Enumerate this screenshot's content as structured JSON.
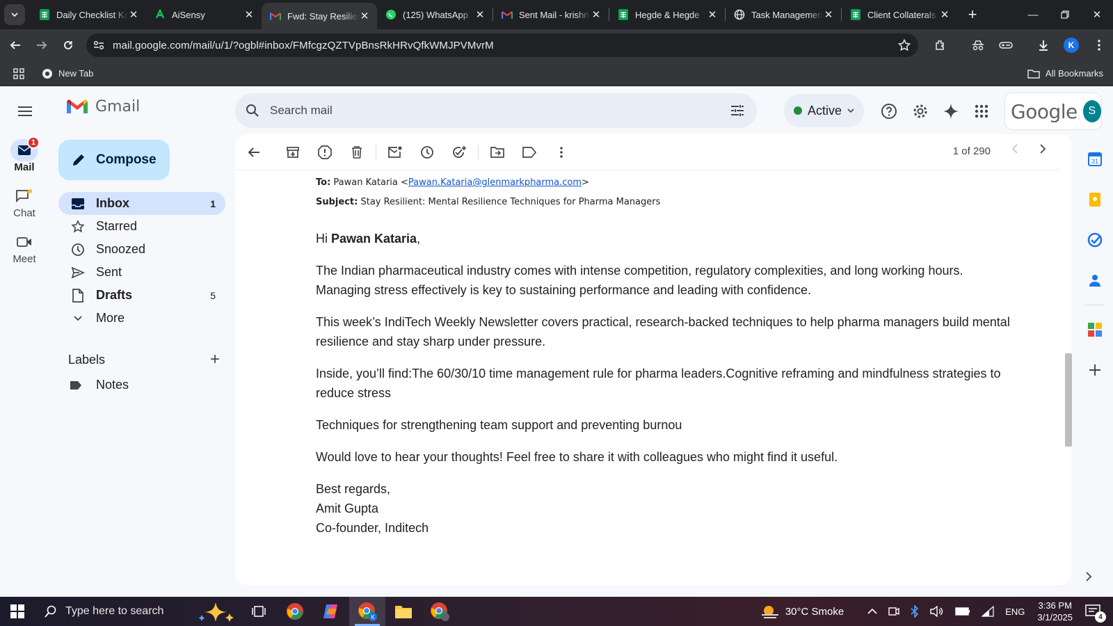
{
  "browser": {
    "tabs": [
      {
        "title": "Daily Checklist Ka",
        "icon": "sheets-icon",
        "active": false
      },
      {
        "title": "AiSensy",
        "icon": "aisensy-icon",
        "active": false
      },
      {
        "title": "Fwd: Stay Resilien",
        "icon": "gmail-icon",
        "active": true
      },
      {
        "title": "(125) WhatsApp",
        "icon": "whatsapp-icon",
        "active": false
      },
      {
        "title": "Sent Mail - krishn",
        "icon": "gmail-icon",
        "active": false
      },
      {
        "title": "Hegde & Hegde",
        "icon": "sheets-icon",
        "active": false
      },
      {
        "title": "Task Management",
        "icon": "globe-icon",
        "active": false
      },
      {
        "title": "Client Collaterals",
        "icon": "sheets-icon",
        "active": false
      }
    ],
    "url": "mail.google.com/mail/u/1/?ogbl#inbox/FMfcgzQZTVpBnsRkHRvQfkWMJPVMvrM",
    "profile_initial": "K",
    "bookmarks": {
      "new_tab": "New Tab",
      "all": "All Bookmarks"
    }
  },
  "gmail": {
    "brand": "Gmail",
    "search_placeholder": "Search mail",
    "status": "Active",
    "google_word": "Google",
    "avatar_initial": "S",
    "rail": [
      {
        "label": "Mail",
        "badge": "1"
      },
      {
        "label": "Chat"
      },
      {
        "label": "Meet"
      }
    ],
    "compose_label": "Compose",
    "nav": [
      {
        "label": "Inbox",
        "count": "1"
      },
      {
        "label": "Starred",
        "count": ""
      },
      {
        "label": "Snoozed",
        "count": ""
      },
      {
        "label": "Sent",
        "count": ""
      },
      {
        "label": "Drafts",
        "count": "5"
      },
      {
        "label": "More",
        "count": ""
      }
    ],
    "labels_title": "Labels",
    "labels": [
      "Notes"
    ],
    "pagination": "1 of 290"
  },
  "email": {
    "to_label": "To:",
    "to_name": "Pawan Kataria <",
    "to_email": "Pawan.Kataria@glenmarkpharma.com",
    "to_close": ">",
    "subject_label": "Subject:",
    "subject": "Stay Resilient: Mental Resilience Techniques for Pharma Managers",
    "greeting_hi": "Hi ",
    "greeting_name": "Pawan Kataria",
    "greeting_comma": ",",
    "paragraphs": [
      "The Indian pharmaceutical industry comes with intense competition, regulatory complexities, and long working hours. Managing stress effectively is key to sustaining performance and leading with confidence.",
      "This week’s IndiTech Weekly Newsletter covers practical, research-backed techniques to help pharma managers build mental resilience and stay sharp under pressure.",
      "Inside, you’ll find:The 60/30/10 time management rule for pharma leaders.Cognitive reframing and mindfulness strategies to reduce stress",
      "Techniques for strengthening team support and preventing burnou",
      "Would love to hear your thoughts! Feel free to share it with colleagues who might find it useful."
    ],
    "signoff": "Best regards,",
    "sender_name": "Amit Gupta",
    "sender_title": "Co-founder, Inditech"
  },
  "taskbar": {
    "search_placeholder": "Type here to search",
    "weather": "30°C  Smoke",
    "language": "ENG",
    "time": "3:36 PM",
    "date": "3/1/2025",
    "notifications": "4"
  }
}
